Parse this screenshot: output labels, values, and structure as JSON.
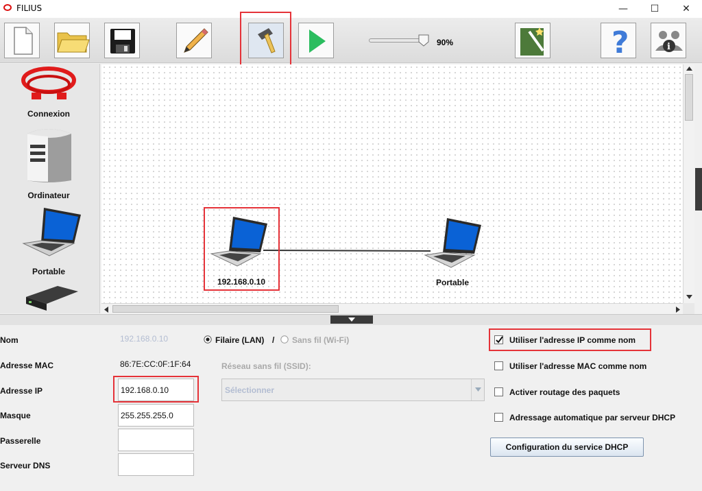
{
  "window": {
    "title": "FILIUS",
    "minimize": "—",
    "maximize": "☐",
    "close": "✕"
  },
  "toolbar": {
    "zoom": "90%",
    "zoom_level": 0.9,
    "buttons": [
      "new-file-icon",
      "open-folder-icon",
      "save-icon",
      "pencil-icon",
      "hammer-icon",
      "play-icon",
      "wizard-icon",
      "help-icon",
      "info-icon"
    ]
  },
  "palette": {
    "items": [
      "Connexion",
      "Ordinateur",
      "Portable"
    ]
  },
  "canvas": {
    "nodes": [
      {
        "label": "192.168.0.10"
      },
      {
        "label": "Portable"
      }
    ]
  },
  "props": {
    "labels": {
      "name": "Nom",
      "mac": "Adresse MAC",
      "ip": "Adresse IP",
      "mask": "Masque",
      "gateway": "Passerelle",
      "dns": "Serveur DNS"
    },
    "values": {
      "name": "192.168.0.10",
      "mac": "86:7E:CC:0F:1F:64",
      "ip": "192.168.0.10",
      "mask": "255.255.255.0",
      "gateway": "",
      "dns": ""
    },
    "conn_wired": "Filaire (LAN)",
    "conn_sep": "/",
    "conn_wifi": "Sans fil (Wi-Fi)",
    "ssid_label": "Réseau sans fil (SSID):",
    "ssid_select": "Sélectionner",
    "options": [
      {
        "label": "Utiliser l'adresse IP comme nom",
        "checked": true
      },
      {
        "label": "Utiliser l'adresse MAC comme nom",
        "checked": false
      },
      {
        "label": "Activer routage des paquets",
        "checked": false
      },
      {
        "label": "Adressage automatique par serveur DHCP",
        "checked": false
      }
    ],
    "dhcp_button": "Configuration du service DHCP"
  },
  "colors": {
    "highlight": "#e53238",
    "selected_text": "#b3bdd2"
  }
}
